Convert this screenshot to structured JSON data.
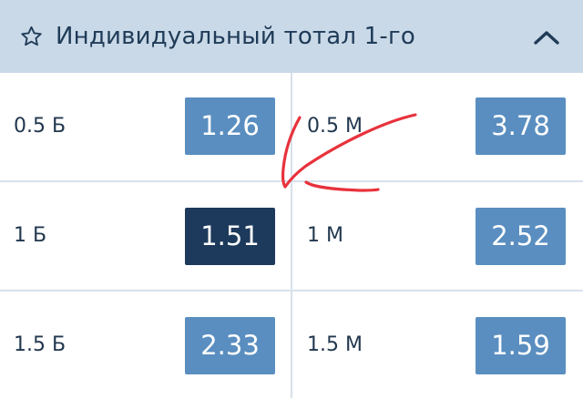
{
  "header": {
    "title": "Индивидуальный тотал 1-го",
    "star_icon": "star-outline-icon",
    "collapse_icon": "chevron-up-icon"
  },
  "rows": [
    {
      "left": {
        "label": "0.5 Б",
        "odd": "1.26",
        "selected": false
      },
      "right": {
        "label": "0.5 М",
        "odd": "3.78",
        "selected": false
      }
    },
    {
      "left": {
        "label": "1 Б",
        "odd": "1.51",
        "selected": true
      },
      "right": {
        "label": "1 М",
        "odd": "2.52",
        "selected": false
      }
    },
    {
      "left": {
        "label": "1.5 Б",
        "odd": "2.33",
        "selected": false
      },
      "right": {
        "label": "1.5 М",
        "odd": "1.59",
        "selected": false
      }
    }
  ],
  "colors": {
    "header_bg": "#c9d9e7",
    "odd_bg": "#5a8ec0",
    "odd_selected_bg": "#1d3a5c",
    "text": "#22384f",
    "annotation": "#e8323c"
  }
}
